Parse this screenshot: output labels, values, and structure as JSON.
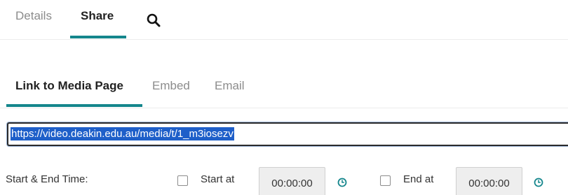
{
  "top_tabs": {
    "details": "Details",
    "share": "Share",
    "search_icon": "search-icon"
  },
  "share_tabs": {
    "link": "Link to Media Page",
    "embed": "Embed",
    "email": "Email"
  },
  "link": {
    "url": "https://video.deakin.edu.au/media/t/1_m3iosezv"
  },
  "time": {
    "label": "Start & End Time:",
    "start_label": "Start at",
    "start_value": "00:00:00",
    "end_label": "End at",
    "end_value": "00:00:00",
    "clock_icon": "clock-icon"
  },
  "colors": {
    "accent": "#14868c",
    "selection": "#1e5fc9",
    "muted_text": "#8c8c8c"
  }
}
